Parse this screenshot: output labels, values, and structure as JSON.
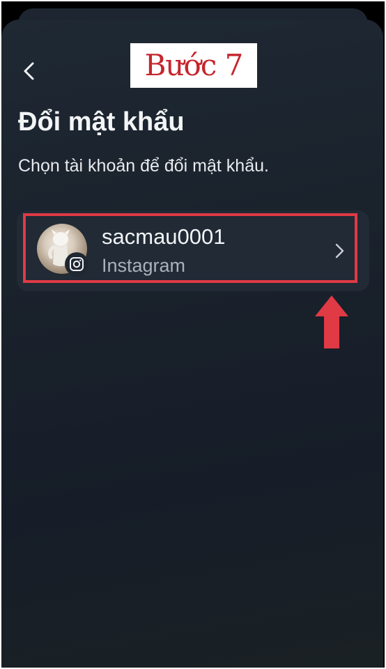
{
  "step_label": "Bước 7",
  "header": {
    "back_icon": "chevron-left-icon",
    "title": "Đổi mật khẩu",
    "subtitle": "Chọn tài khoản để đổi mật khẩu."
  },
  "accounts": [
    {
      "username": "sacmau0001",
      "platform": "Instagram",
      "platform_icon": "instagram-icon",
      "trailing_icon": "chevron-right-icon"
    }
  ],
  "colors": {
    "annotation_red": "#e03a45",
    "background": "#1a222c",
    "card": "#212a35"
  }
}
